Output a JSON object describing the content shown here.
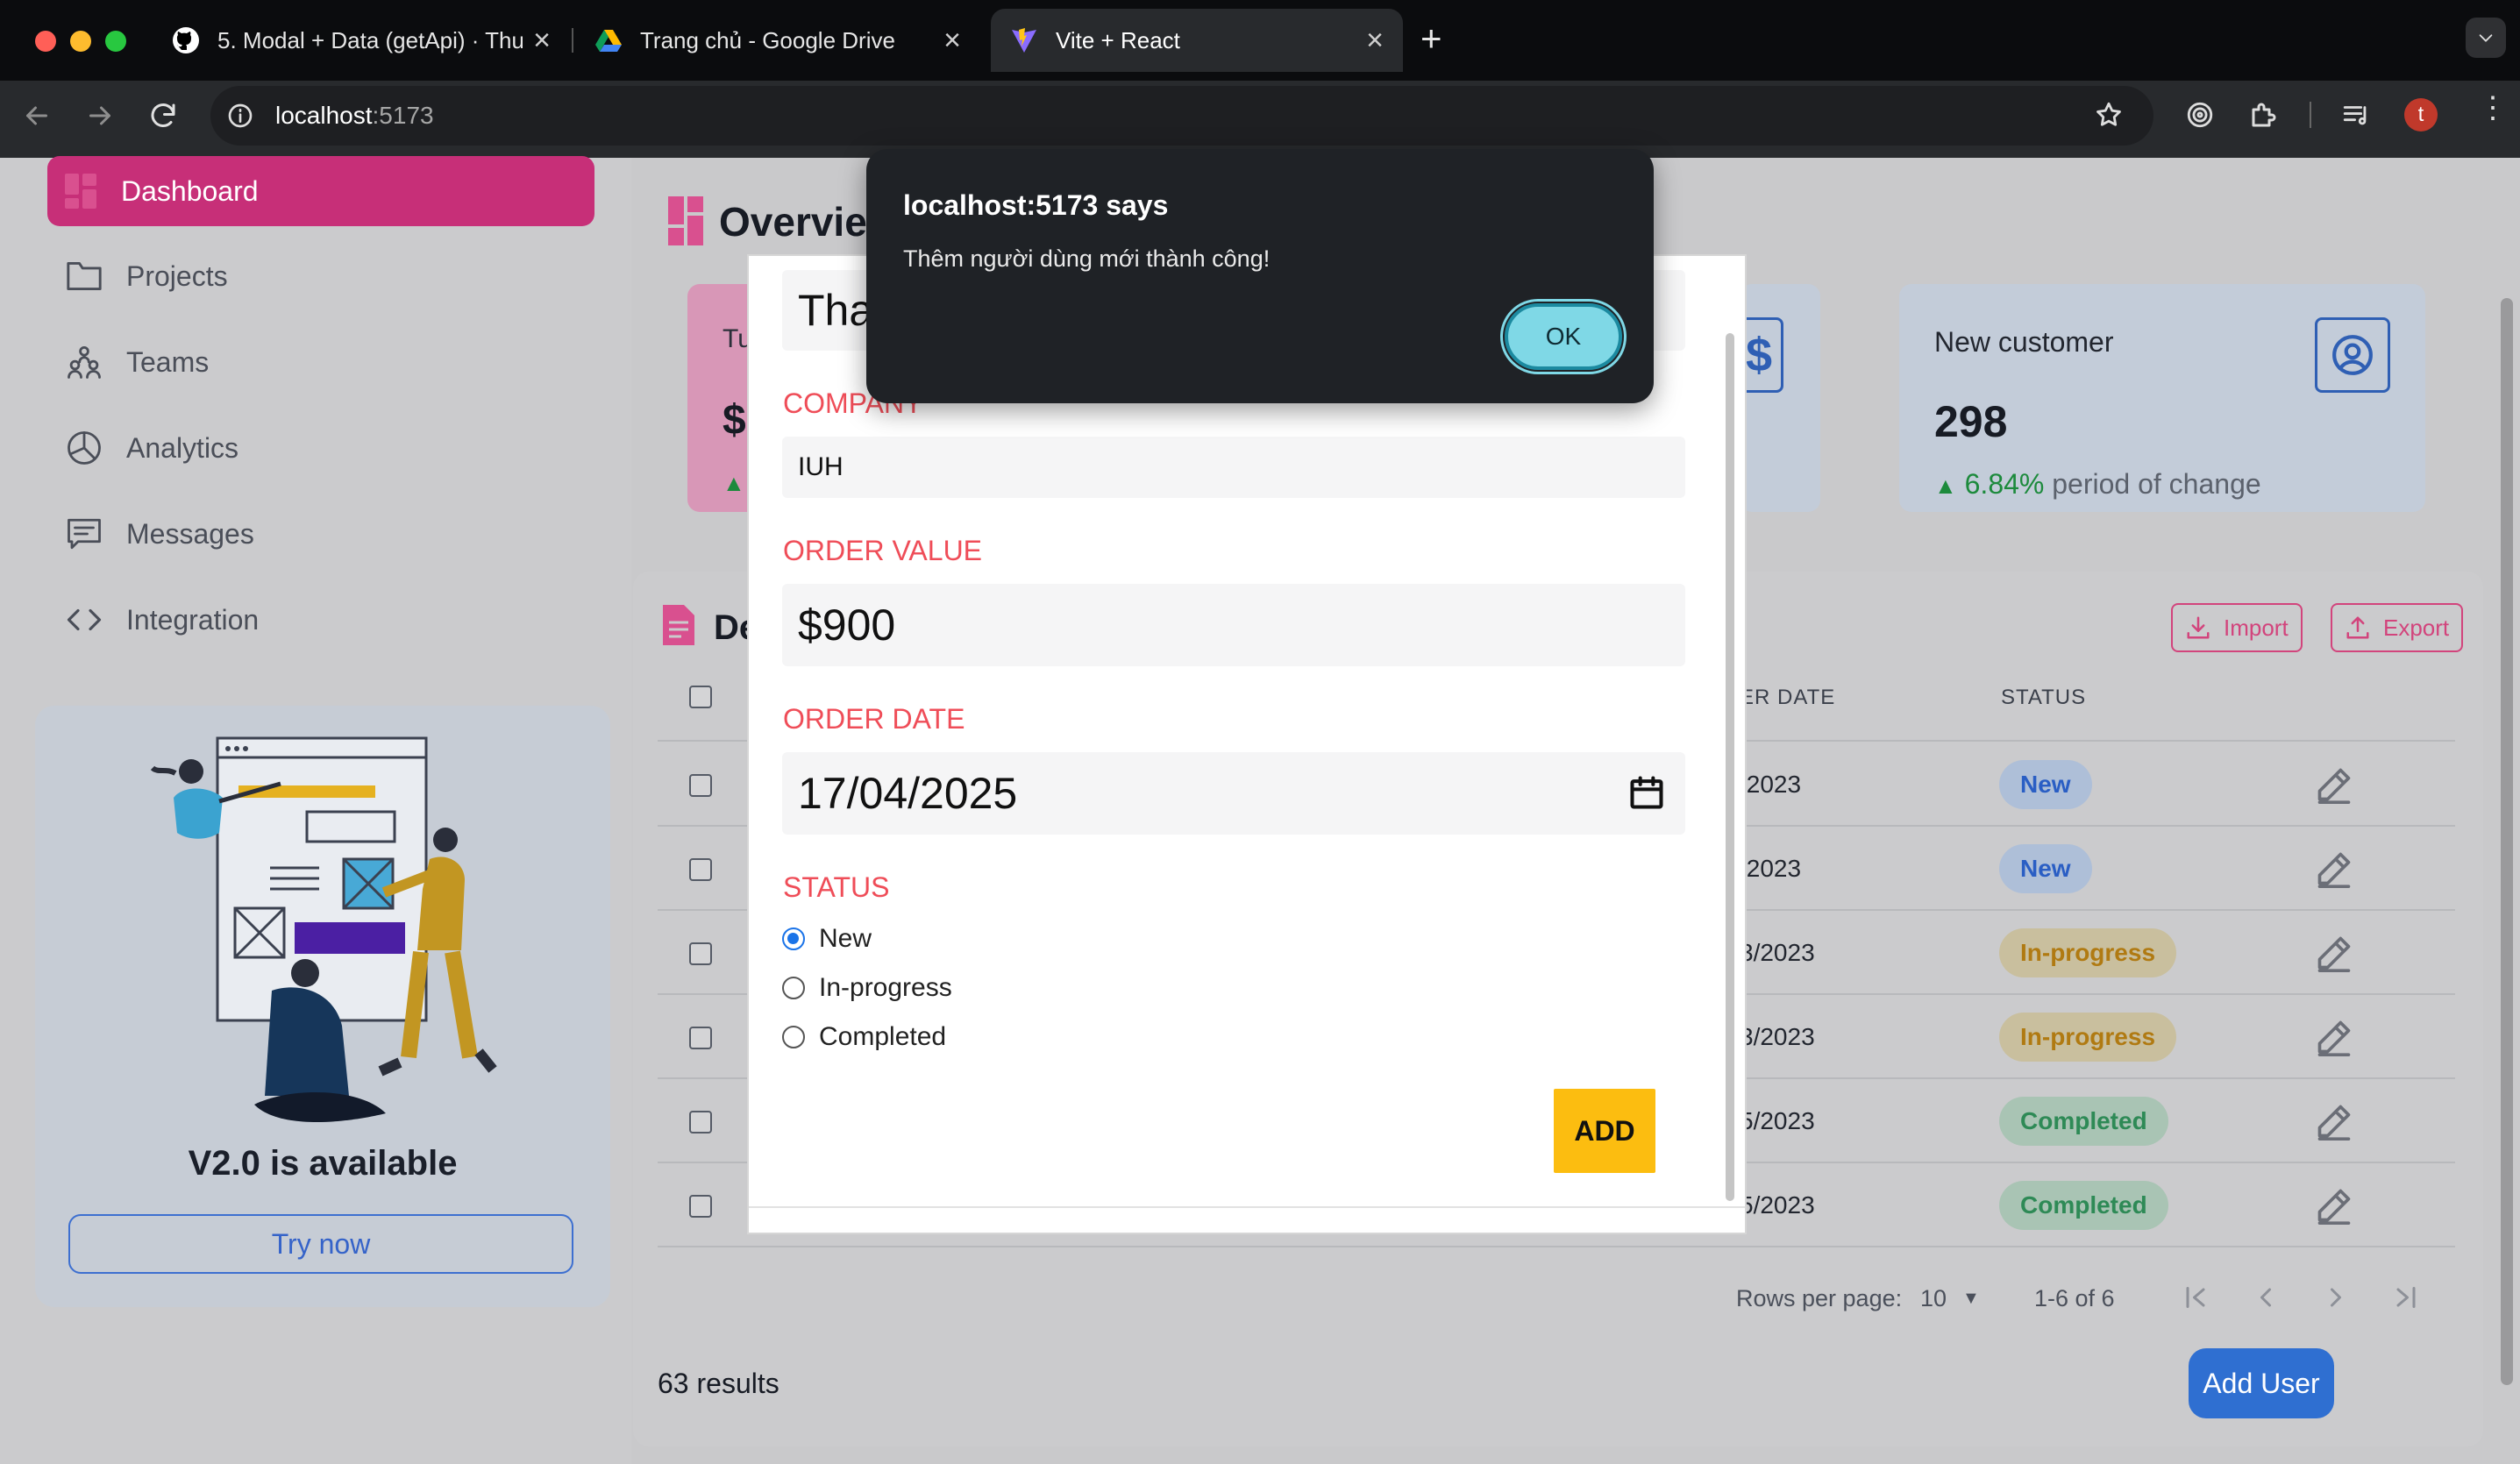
{
  "browser": {
    "tabs": [
      {
        "title": "5. Modal + Data (getApi) · Thu",
        "favicon": "github-icon"
      },
      {
        "title": "Trang chủ - Google Drive",
        "favicon": "google-drive-icon"
      },
      {
        "title": "Vite + React",
        "favicon": "vite-icon"
      }
    ],
    "url_host": "localhost",
    "url_port": ":5173",
    "profile_initial": "t"
  },
  "sidebar": {
    "items": [
      {
        "label": "Dashboard",
        "icon": "dashboard-icon"
      },
      {
        "label": "Projects",
        "icon": "folder-icon"
      },
      {
        "label": "Teams",
        "icon": "teams-icon"
      },
      {
        "label": "Analytics",
        "icon": "pie-chart-icon"
      },
      {
        "label": "Messages",
        "icon": "message-icon"
      },
      {
        "label": "Integration",
        "icon": "code-icon"
      }
    ],
    "promo_title": "V2.0 is available",
    "promo_button": "Try now"
  },
  "overview": {
    "title": "Overvie",
    "card1": {
      "label": "Tu",
      "value": "$"
    },
    "card3": {
      "label": "New customer",
      "value": "298",
      "change": "6.84%",
      "change_text": "period of change"
    }
  },
  "table": {
    "title": "De",
    "import_label": "Import",
    "export_label": "Export",
    "col_date": "ER DATE",
    "col_status": "STATUS",
    "rows": [
      {
        "date": "/2023",
        "status": "New"
      },
      {
        "date": "/2023",
        "status": "New"
      },
      {
        "date": "3/2023",
        "status": "In-progress"
      },
      {
        "date": "3/2023",
        "status": "In-progress"
      },
      {
        "date": "5/2023",
        "status": "Completed"
      },
      {
        "date": "5/2023",
        "status": "Completed"
      }
    ],
    "rows_per_page_label": "Rows per page:",
    "rows_per_page": "10",
    "range": "1-6 of 6",
    "results": "63 results",
    "add_user": "Add User"
  },
  "modal": {
    "name_value": "Tha",
    "company_label": "COMPANY",
    "company_value": "IUH",
    "order_value_label": "ORDER VALUE",
    "order_value": "$900",
    "order_date_label": "ORDER DATE",
    "order_date": "17/04/2025",
    "status_label": "STATUS",
    "status_options": [
      "New",
      "In-progress",
      "Completed"
    ],
    "selected_status": "New",
    "add_button": "ADD"
  },
  "alert": {
    "title": "localhost:5173 says",
    "message": "Thêm người dùng mới thành công!",
    "ok": "OK"
  },
  "colors": {
    "accent": "#c72f78",
    "primary": "#2f6fd1",
    "add_button": "#fcbd10",
    "label_red": "#ef4d58"
  }
}
